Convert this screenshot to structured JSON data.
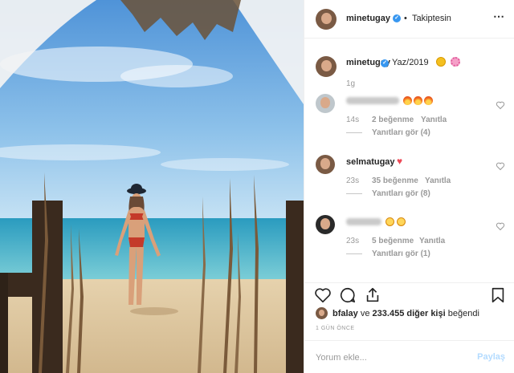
{
  "post": {
    "author": "minetugay",
    "follow_state": "Takiptesin",
    "separator": "•",
    "caption": "Yaz/2019",
    "caption_time": "1g"
  },
  "comments": [
    {
      "username": "",
      "text_icons": [
        "fire-emoji",
        "fire-emoji",
        "fire-emoji"
      ],
      "time": "14s",
      "likes": "2 beğenme",
      "reply_label": "Yanıtla",
      "view_replies": "Yanıtları gör (4)"
    },
    {
      "username": "selmatugay",
      "text_icons": [
        "red-heart-emoji"
      ],
      "time": "23s",
      "likes": "35 beğenme",
      "reply_label": "Yanıtla",
      "view_replies": "Yanıtları gör (8)"
    },
    {
      "username": "",
      "text_icons": [
        "laughing-emoji",
        "laughing-emoji"
      ],
      "time": "23s",
      "likes": "5 beğenme",
      "reply_label": "Yanıtla",
      "view_replies": "Yanıtları gör (1)"
    }
  ],
  "likes": {
    "first_user": "bfalay",
    "connector": "ve",
    "others": "233.455 diğer kişi",
    "suffix": "beğendi"
  },
  "posted_ago": "1 GÜN ÖNCE",
  "comment_box": {
    "placeholder": "Yorum ekle...",
    "post_label": "Paylaş"
  },
  "colors": {
    "verified": "#3897f0",
    "heart": "#ed4956",
    "post_disabled": "#b3dbff",
    "muted": "#999999"
  }
}
